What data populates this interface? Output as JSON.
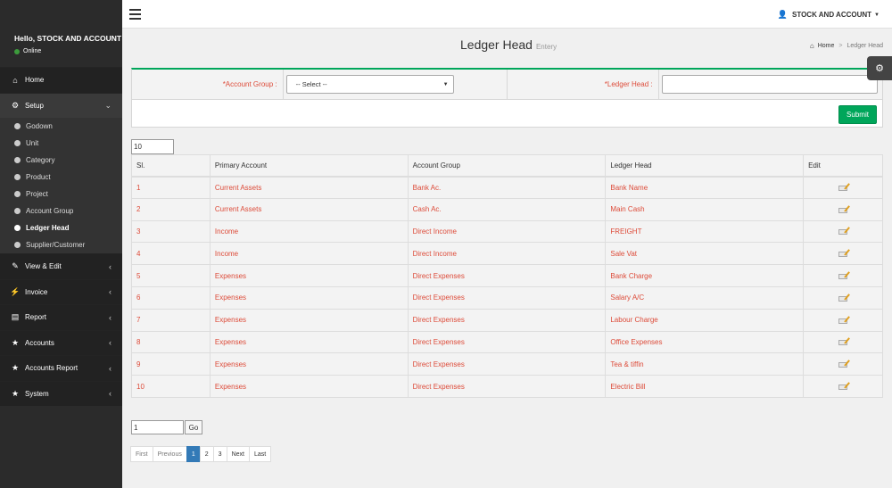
{
  "sidebar": {
    "greeting": "Hello, STOCK AND ACCOUNT",
    "status": "Online",
    "items": [
      {
        "label": "Home",
        "icon": "home-icon"
      },
      {
        "label": "Setup",
        "icon": "cogs-icon"
      },
      {
        "label": "View & Edit",
        "icon": "edit-icon"
      },
      {
        "label": "Invoice",
        "icon": "plug-icon"
      },
      {
        "label": "Report",
        "icon": "file-icon"
      },
      {
        "label": "Accounts",
        "icon": "star-icon"
      },
      {
        "label": "Accounts Report",
        "icon": "star-icon"
      },
      {
        "label": "System",
        "icon": "star-icon"
      }
    ],
    "setup_sub": [
      "Godown",
      "Unit",
      "Category",
      "Product",
      "Project",
      "Account Group",
      "Ledger Head",
      "Supplier/Customer"
    ]
  },
  "topbar": {
    "account": "STOCK AND ACCOUNT"
  },
  "page": {
    "title": "Ledger Head",
    "subtitle": "Entery",
    "breadcrumb": [
      "Home",
      "Ledger Head"
    ]
  },
  "form": {
    "account_group_label": "*Account Group :",
    "account_group_value": "-- Select --",
    "ledger_head_label": "*Ledger Head :",
    "submit": "Submit"
  },
  "page_size": "10",
  "table": {
    "headers": [
      "Sl.",
      "Primary Account",
      "Account Group",
      "Ledger Head",
      "Edit"
    ],
    "rows": [
      [
        "1",
        "Current Assets",
        "Bank Ac.",
        "Bank Name"
      ],
      [
        "2",
        "Current Assets",
        "Cash Ac.",
        "Main Cash"
      ],
      [
        "3",
        "Income",
        "Direct Income",
        "FREIGHT"
      ],
      [
        "4",
        "Income",
        "Direct Income",
        "Sale Vat"
      ],
      [
        "5",
        "Expenses",
        "Direct Expenses",
        "Bank Charge"
      ],
      [
        "6",
        "Expenses",
        "Direct Expenses",
        "Salary A/C"
      ],
      [
        "7",
        "Expenses",
        "Direct Expenses",
        "Labour Charge"
      ],
      [
        "8",
        "Expenses",
        "Direct Expenses",
        "Office Expenses"
      ],
      [
        "9",
        "Expenses",
        "Direct Expenses",
        "Tea & tiffin"
      ],
      [
        "10",
        "Expenses",
        "Direct Expenses",
        "Electric Bill"
      ]
    ]
  },
  "goto": {
    "value": "1",
    "button": "Go"
  },
  "pagination": [
    "First",
    "Previous",
    "1",
    "2",
    "3",
    "Next",
    "Last"
  ],
  "colors": {
    "accent": "#00a65a",
    "link": "#dd4b39",
    "sidebar": "#2b2b2b",
    "active_page": "#337ab7"
  }
}
